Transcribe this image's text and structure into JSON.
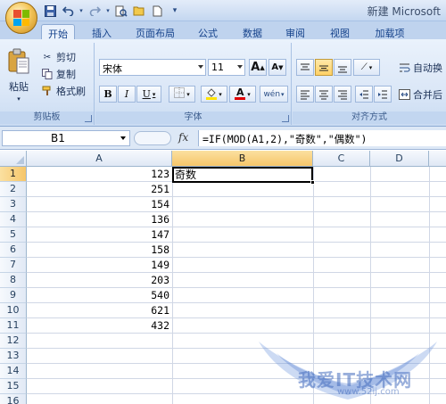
{
  "window": {
    "title": "新建 Microsoft"
  },
  "qat": {
    "icons": [
      "save-icon",
      "undo-icon",
      "redo-icon",
      "print-preview-icon",
      "open-icon",
      "new-icon",
      "customize-icon"
    ]
  },
  "tabs": [
    {
      "label": "开始",
      "active": true
    },
    {
      "label": "插入",
      "active": false
    },
    {
      "label": "页面布局",
      "active": false
    },
    {
      "label": "公式",
      "active": false
    },
    {
      "label": "数据",
      "active": false
    },
    {
      "label": "审阅",
      "active": false
    },
    {
      "label": "视图",
      "active": false
    },
    {
      "label": "加载项",
      "active": false
    }
  ],
  "clipboard": {
    "paste_label": "粘贴",
    "cut_label": "剪切",
    "copy_label": "复制",
    "format_painter_label": "格式刷",
    "group_label": "剪贴板"
  },
  "font": {
    "font_name": "宋体",
    "font_size": "11",
    "grow_label": "A",
    "shrink_label": "A",
    "bold_label": "B",
    "italic_label": "I",
    "underline_label": "U",
    "font_color_label": "A",
    "phonetic_label": "wén",
    "group_label": "字体",
    "font_color": "#e00000",
    "fill_color": "#ffe200"
  },
  "alignment": {
    "wrap_label": "自动换",
    "merge_label": "合并后",
    "group_label": "对齐方式"
  },
  "formula_bar": {
    "name_box": "B1",
    "fx_label": "fx",
    "formula": "=IF(MOD(A1,2),\"奇数\",\"偶数\")"
  },
  "grid": {
    "columns": [
      "A",
      "B",
      "C",
      "D"
    ],
    "rows": [
      "1",
      "2",
      "3",
      "4",
      "5",
      "6",
      "7",
      "8",
      "9",
      "10",
      "11",
      "12",
      "13",
      "14",
      "15",
      "16"
    ],
    "col_a_values": [
      "123",
      "251",
      "154",
      "136",
      "147",
      "158",
      "149",
      "203",
      "540",
      "621",
      "432"
    ],
    "b1_value": "奇数",
    "active_cell": "B1"
  },
  "watermark": {
    "text": "我爱IT技术网",
    "url": "www.52ij.com"
  }
}
